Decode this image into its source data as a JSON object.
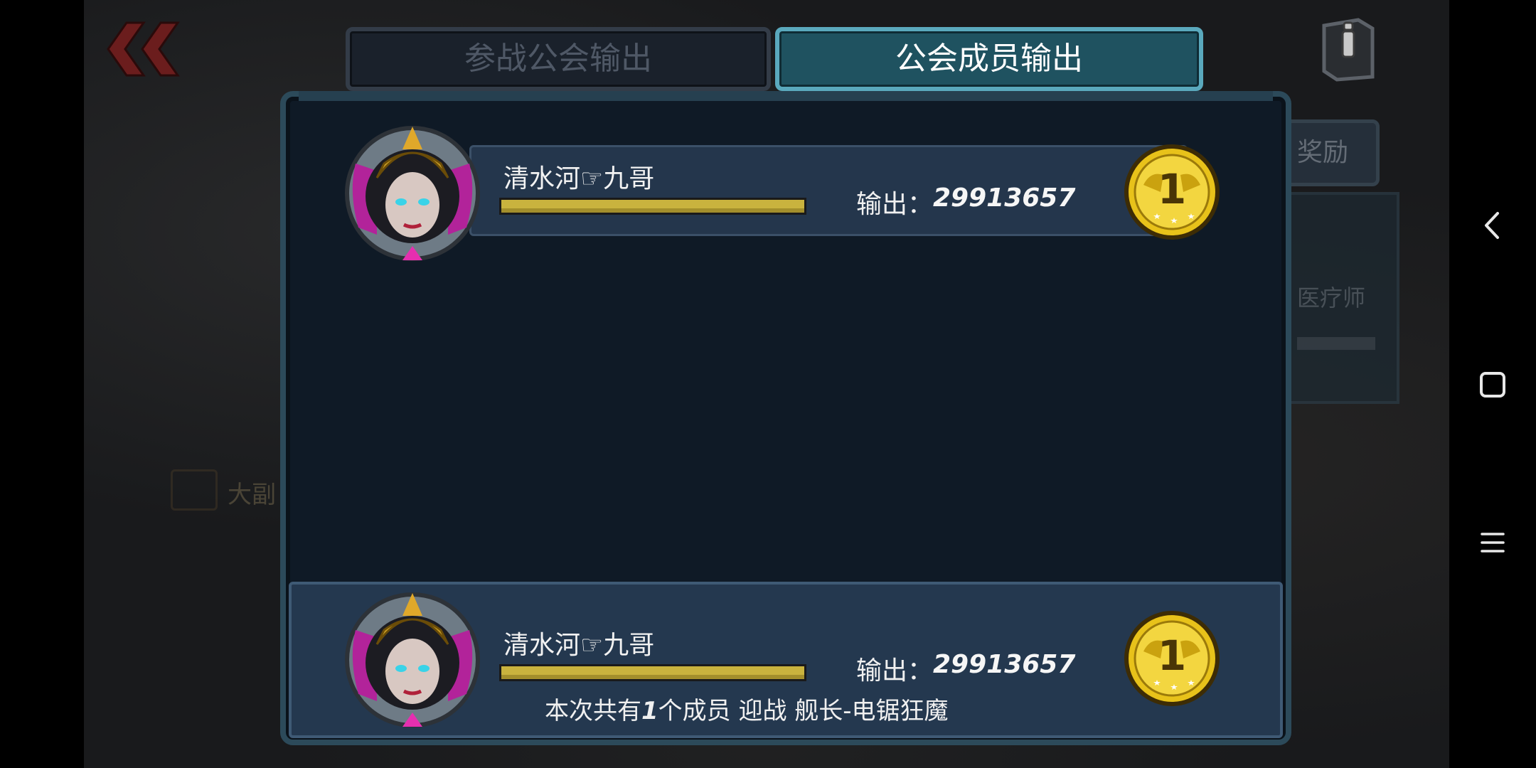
{
  "tabs": {
    "inactive_label": "参战公会输出",
    "active_label": "公会成员输出"
  },
  "side": {
    "reward_label": "奖励",
    "partial_text": "医疗师",
    "dim_text": "大副"
  },
  "rows": [
    {
      "name": "清水河☞九哥",
      "damage_label": "输出：",
      "damage_value": "29913657",
      "rank": "1"
    }
  ],
  "self_row": {
    "name": "清水河☞九哥",
    "damage_label": "输出：",
    "damage_value": "29913657",
    "rank": "1"
  },
  "summary": {
    "prefix": "本次共有",
    "count": "1",
    "suffix": "个成员 迎战 舰长-电锯狂魔"
  },
  "icons": {
    "back": "double-chevron-left-icon",
    "info": "info-book-icon",
    "nav_back": "back-triangle-icon",
    "nav_home": "home-square-icon",
    "nav_menu": "menu-lines-icon"
  },
  "colors": {
    "active_tab": "#1f5260",
    "active_tab_border": "#5aa9bd",
    "panel_bg": "#0f1a26",
    "row_band": "#24364c",
    "hp_bar": "#c9b33e",
    "medal_gold": "#e8c21a"
  }
}
